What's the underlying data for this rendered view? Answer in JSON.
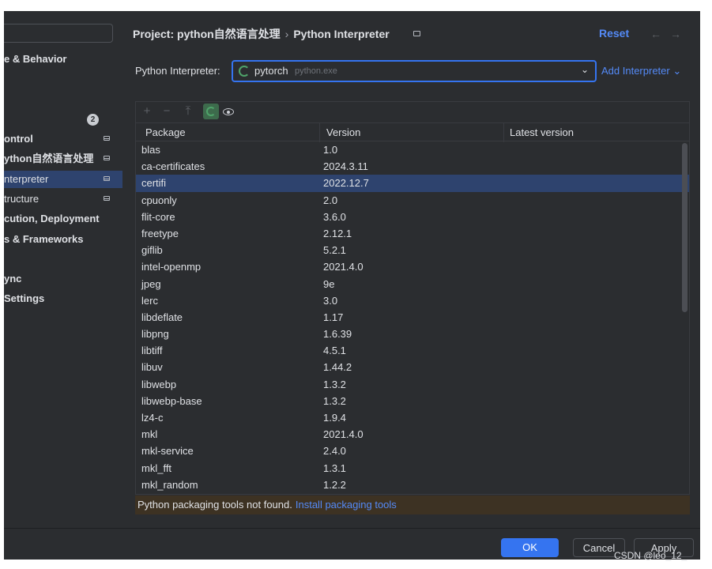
{
  "sidebar": {
    "items": [
      {
        "label": "e & Behavior",
        "pin": false,
        "selected": false,
        "sub": false
      },
      {
        "label": "ontrol",
        "pin": true,
        "selected": false,
        "sub": false
      },
      {
        "label": "ython自然语言处理",
        "pin": true,
        "selected": false,
        "sub": false
      },
      {
        "label": "nterpreter",
        "pin": true,
        "selected": true,
        "sub": true
      },
      {
        "label": "tructure",
        "pin": true,
        "selected": false,
        "sub": true
      },
      {
        "label": "cution, Deployment",
        "pin": false,
        "selected": false,
        "sub": false
      },
      {
        "label": "s & Frameworks",
        "pin": false,
        "selected": false,
        "sub": false
      },
      {
        "label": "ync",
        "pin": false,
        "selected": false,
        "sub": false
      },
      {
        "label": "Settings",
        "pin": false,
        "selected": false,
        "sub": false
      }
    ],
    "badge": "2"
  },
  "header": {
    "project": "Project: python自然语言处理",
    "separator": "›",
    "page": "Python Interpreter",
    "reset": "Reset",
    "back_arrow": "←",
    "forward_arrow": "→"
  },
  "interpreter": {
    "label": "Python Interpreter:",
    "name": "pytorch",
    "path": "python.exe",
    "chevron": "⌄",
    "add_label": "Add Interpreter ⌄"
  },
  "toolbar": {
    "add": "+",
    "remove": "−",
    "upgrade": "⤒"
  },
  "table": {
    "columns": [
      "Package",
      "Version",
      "Latest version"
    ],
    "rows": [
      {
        "package": "blas",
        "version": "1.0",
        "latest": ""
      },
      {
        "package": "ca-certificates",
        "version": "2024.3.11",
        "latest": ""
      },
      {
        "package": "certifi",
        "version": "2022.12.7",
        "latest": "",
        "selected": true
      },
      {
        "package": "cpuonly",
        "version": "2.0",
        "latest": ""
      },
      {
        "package": "flit-core",
        "version": "3.6.0",
        "latest": ""
      },
      {
        "package": "freetype",
        "version": "2.12.1",
        "latest": ""
      },
      {
        "package": "giflib",
        "version": "5.2.1",
        "latest": ""
      },
      {
        "package": "intel-openmp",
        "version": "2021.4.0",
        "latest": ""
      },
      {
        "package": "jpeg",
        "version": "9e",
        "latest": ""
      },
      {
        "package": "lerc",
        "version": "3.0",
        "latest": ""
      },
      {
        "package": "libdeflate",
        "version": "1.17",
        "latest": ""
      },
      {
        "package": "libpng",
        "version": "1.6.39",
        "latest": ""
      },
      {
        "package": "libtiff",
        "version": "4.5.1",
        "latest": ""
      },
      {
        "package": "libuv",
        "version": "1.44.2",
        "latest": ""
      },
      {
        "package": "libwebp",
        "version": "1.3.2",
        "latest": ""
      },
      {
        "package": "libwebp-base",
        "version": "1.3.2",
        "latest": ""
      },
      {
        "package": "lz4-c",
        "version": "1.9.4",
        "latest": ""
      },
      {
        "package": "mkl",
        "version": "2021.4.0",
        "latest": ""
      },
      {
        "package": "mkl-service",
        "version": "2.4.0",
        "latest": ""
      },
      {
        "package": "mkl_fft",
        "version": "1.3.1",
        "latest": ""
      },
      {
        "package": "mkl_random",
        "version": "1.2.2",
        "latest": ""
      }
    ]
  },
  "notice": {
    "text": "Python packaging tools not found.",
    "link": "Install packaging tools"
  },
  "buttons": {
    "ok": "OK",
    "cancel": "Cancel",
    "apply": "Apply"
  },
  "watermark": "CSDN @leo_12_",
  "colors": {
    "background": "#2b2d30",
    "accent": "#3574f0",
    "link": "#548af7",
    "selection": "#2e436e",
    "notice_bg": "#3d3223",
    "spinner": "#4fa36a"
  }
}
